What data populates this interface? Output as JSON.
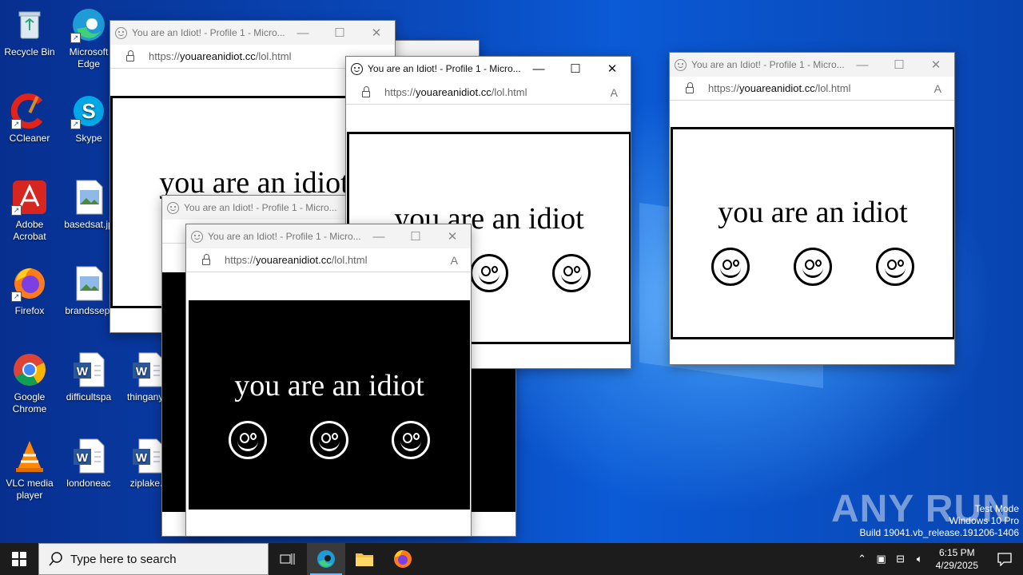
{
  "desktop": {
    "icons": [
      {
        "label": "Recycle Bin",
        "icon": "recycle-bin-icon"
      },
      {
        "label": "Microsoft Edge",
        "icon": "edge-icon"
      },
      {
        "label": "CCleaner",
        "icon": "ccleaner-icon"
      },
      {
        "label": "Skype",
        "icon": "skype-icon"
      },
      {
        "label": "Adobe Acrobat",
        "icon": "acrobat-icon"
      },
      {
        "label": "basedsat.jp",
        "icon": "image-file-icon"
      },
      {
        "label": "Firefox",
        "icon": "firefox-icon"
      },
      {
        "label": "brandssep.",
        "icon": "image-file-icon"
      },
      {
        "label": "Google Chrome",
        "icon": "chrome-icon"
      },
      {
        "label": "difficultspa",
        "icon": "word-doc-icon"
      },
      {
        "label": "thinganyo",
        "icon": "word-doc-icon"
      },
      {
        "label": "VLC media player",
        "icon": "vlc-icon"
      },
      {
        "label": "londoneac",
        "icon": "word-doc-icon"
      },
      {
        "label": "ziplake.r",
        "icon": "word-doc-icon"
      }
    ]
  },
  "popup": {
    "title": "You are an Idiot! - Profile 1 - Micro...",
    "url_prefix": "https://",
    "url_domain": "youareanidiot.cc",
    "url_path": "/lol.html",
    "message": "you are an idiot",
    "read_aloud": "A",
    "minimize": "—",
    "maximize": "☐",
    "close": "✕"
  },
  "watermark": {
    "brand": "ANY RUN",
    "line1": "Test Mode",
    "line2": "Windows 10 Pro",
    "line3": "Build 19041.vb_release.191206-1406"
  },
  "taskbar": {
    "search_placeholder": "Type here to search",
    "time": "6:15 PM",
    "date": "4/29/2025",
    "accent": "#7ab8f5"
  }
}
